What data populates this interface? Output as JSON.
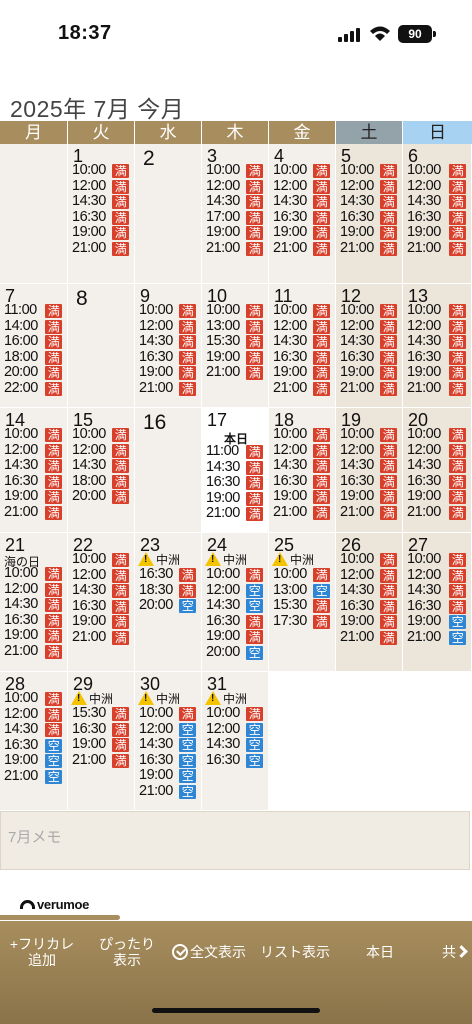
{
  "status_bar": {
    "time": "18:37",
    "battery": "90"
  },
  "header": {
    "month_title": "2025年 7月 今月"
  },
  "weekdays": [
    "月",
    "火",
    "水",
    "木",
    "金",
    "土",
    "日"
  ],
  "calendar": {
    "weeks": [
      [
        null,
        {
          "day": "1",
          "slots": [
            [
              "10:00",
              "満"
            ],
            [
              "12:00",
              "満"
            ],
            [
              "14:30",
              "満"
            ],
            [
              "16:30",
              "満"
            ],
            [
              "19:00",
              "満"
            ],
            [
              "21:00",
              "満"
            ]
          ]
        },
        {
          "day": "2",
          "slots": []
        },
        {
          "day": "3",
          "slots": [
            [
              "10:00",
              "満"
            ],
            [
              "12:00",
              "満"
            ],
            [
              "14:30",
              "満"
            ],
            [
              "17:00",
              "満"
            ],
            [
              "19:00",
              "満"
            ],
            [
              "21:00",
              "満"
            ]
          ]
        },
        {
          "day": "4",
          "slots": [
            [
              "10:00",
              "満"
            ],
            [
              "12:00",
              "満"
            ],
            [
              "14:30",
              "満"
            ],
            [
              "16:30",
              "満"
            ],
            [
              "19:00",
              "満"
            ],
            [
              "21:00",
              "満"
            ]
          ]
        },
        {
          "day": "5",
          "slots": [
            [
              "10:00",
              "満"
            ],
            [
              "12:00",
              "満"
            ],
            [
              "14:30",
              "満"
            ],
            [
              "16:30",
              "満"
            ],
            [
              "19:00",
              "満"
            ],
            [
              "21:00",
              "満"
            ]
          ]
        },
        {
          "day": "6",
          "slots": [
            [
              "10:00",
              "満"
            ],
            [
              "12:00",
              "満"
            ],
            [
              "14:30",
              "満"
            ],
            [
              "16:30",
              "満"
            ],
            [
              "19:00",
              "満"
            ],
            [
              "21:00",
              "満"
            ]
          ]
        }
      ],
      [
        {
          "day": "7",
          "slots": [
            [
              "11:00",
              "満"
            ],
            [
              "14:00",
              "満"
            ],
            [
              "16:00",
              "満"
            ],
            [
              "18:00",
              "満"
            ],
            [
              "20:00",
              "満"
            ],
            [
              "22:00",
              "満"
            ]
          ]
        },
        {
          "day": "8",
          "slots": []
        },
        {
          "day": "9",
          "slots": [
            [
              "10:00",
              "満"
            ],
            [
              "12:00",
              "満"
            ],
            [
              "14:30",
              "満"
            ],
            [
              "16:30",
              "満"
            ],
            [
              "19:00",
              "満"
            ],
            [
              "21:00",
              "満"
            ]
          ]
        },
        {
          "day": "10",
          "slots": [
            [
              "10:00",
              "満"
            ],
            [
              "13:00",
              "満"
            ],
            [
              "15:30",
              "満"
            ],
            [
              "19:00",
              "満"
            ],
            [
              "21:00",
              "満"
            ]
          ]
        },
        {
          "day": "11",
          "slots": [
            [
              "10:00",
              "満"
            ],
            [
              "12:00",
              "満"
            ],
            [
              "14:30",
              "満"
            ],
            [
              "16:30",
              "満"
            ],
            [
              "19:00",
              "満"
            ],
            [
              "21:00",
              "満"
            ]
          ]
        },
        {
          "day": "12",
          "slots": [
            [
              "10:00",
              "満"
            ],
            [
              "12:00",
              "満"
            ],
            [
              "14:30",
              "満"
            ],
            [
              "16:30",
              "満"
            ],
            [
              "19:00",
              "満"
            ],
            [
              "21:00",
              "満"
            ]
          ]
        },
        {
          "day": "13",
          "slots": [
            [
              "10:00",
              "満"
            ],
            [
              "12:00",
              "満"
            ],
            [
              "14:30",
              "満"
            ],
            [
              "16:30",
              "満"
            ],
            [
              "19:00",
              "満"
            ],
            [
              "21:00",
              "満"
            ]
          ]
        }
      ],
      [
        {
          "day": "14",
          "slots": [
            [
              "10:00",
              "満"
            ],
            [
              "12:00",
              "満"
            ],
            [
              "14:30",
              "満"
            ],
            [
              "16:30",
              "満"
            ],
            [
              "19:00",
              "満"
            ],
            [
              "21:00",
              "満"
            ]
          ]
        },
        {
          "day": "15",
          "slots": [
            [
              "10:00",
              "満"
            ],
            [
              "12:00",
              "満"
            ],
            [
              "14:30",
              "満"
            ],
            [
              "18:00",
              "満"
            ],
            [
              "20:00",
              "満"
            ]
          ]
        },
        {
          "day": "16",
          "slots": []
        },
        {
          "day": "17",
          "today_label": "本日",
          "slots": [
            [
              "11:00",
              "満"
            ],
            [
              "14:30",
              "満"
            ],
            [
              "16:30",
              "満"
            ],
            [
              "19:00",
              "満"
            ],
            [
              "21:00",
              "満"
            ]
          ]
        },
        {
          "day": "18",
          "slots": [
            [
              "10:00",
              "満"
            ],
            [
              "12:00",
              "満"
            ],
            [
              "14:30",
              "満"
            ],
            [
              "16:30",
              "満"
            ],
            [
              "19:00",
              "満"
            ],
            [
              "21:00",
              "満"
            ]
          ]
        },
        {
          "day": "19",
          "slots": [
            [
              "10:00",
              "満"
            ],
            [
              "12:00",
              "満"
            ],
            [
              "14:30",
              "満"
            ],
            [
              "16:30",
              "満"
            ],
            [
              "19:00",
              "満"
            ],
            [
              "21:00",
              "満"
            ]
          ]
        },
        {
          "day": "20",
          "slots": [
            [
              "10:00",
              "満"
            ],
            [
              "12:00",
              "満"
            ],
            [
              "14:30",
              "満"
            ],
            [
              "16:30",
              "満"
            ],
            [
              "19:00",
              "満"
            ],
            [
              "21:00",
              "満"
            ]
          ]
        }
      ],
      [
        {
          "day": "21",
          "holiday": "海の日",
          "slots": [
            [
              "10:00",
              "満"
            ],
            [
              "12:00",
              "満"
            ],
            [
              "14:30",
              "満"
            ],
            [
              "16:30",
              "満"
            ],
            [
              "19:00",
              "満"
            ],
            [
              "21:00",
              "満"
            ]
          ]
        },
        {
          "day": "22",
          "slots": [
            [
              "10:00",
              "満"
            ],
            [
              "12:00",
              "満"
            ],
            [
              "14:30",
              "満"
            ],
            [
              "16:30",
              "満"
            ],
            [
              "19:00",
              "満"
            ],
            [
              "21:00",
              "満"
            ]
          ]
        },
        {
          "day": "23",
          "notice": "中洲",
          "slots": [
            [
              "16:30",
              "満"
            ],
            [
              "18:30",
              "満"
            ],
            [
              "20:00",
              "空"
            ]
          ]
        },
        {
          "day": "24",
          "notice": "中洲",
          "slots": [
            [
              "10:00",
              "満"
            ],
            [
              "12:00",
              "空"
            ],
            [
              "14:30",
              "空"
            ],
            [
              "16:30",
              "満"
            ],
            [
              "19:00",
              "満"
            ],
            [
              "20:00",
              "空"
            ]
          ]
        },
        {
          "day": "25",
          "notice": "中洲",
          "slots": [
            [
              "10:00",
              "満"
            ],
            [
              "13:00",
              "空"
            ],
            [
              "15:30",
              "満"
            ],
            [
              "17:30",
              "満"
            ]
          ]
        },
        {
          "day": "26",
          "slots": [
            [
              "10:00",
              "満"
            ],
            [
              "12:00",
              "満"
            ],
            [
              "14:30",
              "満"
            ],
            [
              "16:30",
              "満"
            ],
            [
              "19:00",
              "満"
            ],
            [
              "21:00",
              "満"
            ]
          ]
        },
        {
          "day": "27",
          "slots": [
            [
              "10:00",
              "満"
            ],
            [
              "12:00",
              "満"
            ],
            [
              "14:30",
              "満"
            ],
            [
              "16:30",
              "満"
            ],
            [
              "19:00",
              "空"
            ],
            [
              "21:00",
              "空"
            ]
          ]
        }
      ],
      [
        {
          "day": "28",
          "slots": [
            [
              "10:00",
              "満"
            ],
            [
              "12:00",
              "満"
            ],
            [
              "14:30",
              "満"
            ],
            [
              "16:30",
              "空"
            ],
            [
              "19:00",
              "空"
            ],
            [
              "21:00",
              "空"
            ]
          ]
        },
        {
          "day": "29",
          "notice": "中洲",
          "slots": [
            [
              "15:30",
              "満"
            ],
            [
              "16:30",
              "満"
            ],
            [
              "19:00",
              "満"
            ],
            [
              "21:00",
              "満"
            ]
          ]
        },
        {
          "day": "30",
          "notice": "中洲",
          "slots": [
            [
              "10:00",
              "満"
            ],
            [
              "12:00",
              "空"
            ],
            [
              "14:30",
              "空"
            ],
            [
              "16:30",
              "空"
            ],
            [
              "19:00",
              "空"
            ],
            [
              "21:00",
              "空"
            ]
          ]
        },
        {
          "day": "31",
          "notice": "中洲",
          "slots": [
            [
              "10:00",
              "満"
            ],
            [
              "12:00",
              "空"
            ],
            [
              "14:30",
              "空"
            ],
            [
              "16:30",
              "空"
            ]
          ]
        },
        null,
        null,
        null
      ]
    ]
  },
  "memo": {
    "placeholder": "7月メモ"
  },
  "brand": {
    "name": "verumoe"
  },
  "toolbar": {
    "add_line1": "+フリカレ",
    "add_line2": "追加",
    "fit_line1": "ぴったり",
    "fit_line2": "表示",
    "fulltext": "全文表示",
    "list": "リスト表示",
    "today": "本日",
    "share": "共"
  },
  "colors": {
    "accent": "#a88e5e",
    "full_badge": "#d8402c",
    "empty_badge": "#2f86d5",
    "saturday": "#94a2aa",
    "sunday": "#a8d2f2"
  }
}
